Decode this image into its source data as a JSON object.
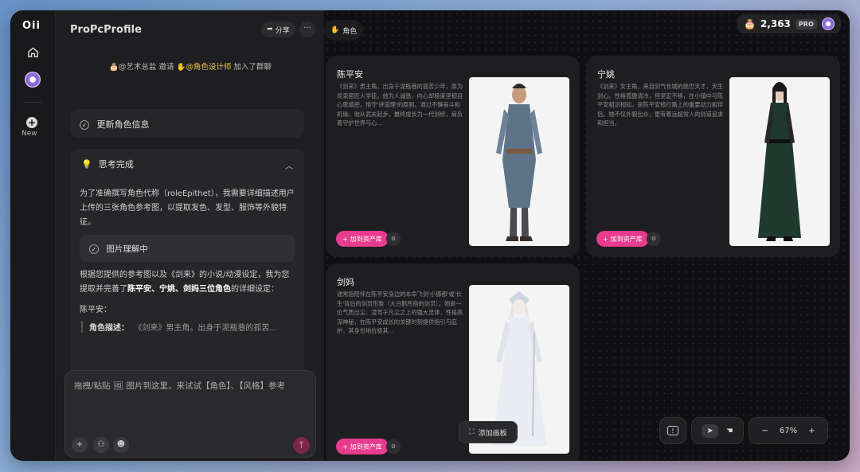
{
  "app": {
    "logo": "Oii",
    "new_label": "New"
  },
  "chat": {
    "title": "ProPcProfile",
    "share_label": "分享",
    "more_label": "···",
    "join_actor": "@艺术总监",
    "join_verb": "邀请",
    "join_target": "@角色设计师",
    "join_suffix": "加入了群聊",
    "update_card": "更新角色信息",
    "think_title": "思考完成",
    "think_para1": "为了准确撰写角色代称（roleEpithet），我需要详细描述用户上传的三张角色参考图，以提取发色、发型、服饰等外貌特征。",
    "sub_card": "图片理解中",
    "think_para2_a": "根据您提供的参考图以及《剑来》的小说/动漫设定，我为您提取并完善了",
    "think_para2_b": "陈平安、宁姚、剑妈三位角色",
    "think_para2_c": "的详细设定：",
    "char_label": "陈平安：",
    "quote_key": "角色描述：",
    "quote_val": "《剑来》男主角。出身于泥瓶巷的孤苦...",
    "input_placeholder": "拖拽/粘贴 🖼 图片到这里，来试试【角色】、【风格】参考"
  },
  "canvas": {
    "tag": "角色",
    "credits": "2,363",
    "plan": "PRO",
    "add_board": "添加画板",
    "zoom": "67%",
    "characters": [
      {
        "name": "陈平安",
        "desc": "《剑来》男主角。出身于泥瓶巷的孤苦少年，原为龙泉窑匠人学徒。他为人诚恳，内心却极度坚韧且心思缜密，恪守'讲道理'的原则。通过不懈奋斗和机缘，他从武夫起步，最终成长为一代剑修，肩负着守护世界与心...",
        "action": "加到资产库"
      },
      {
        "name": "宁姚",
        "desc": "《剑来》女主角。来自剑气长城的绝世天才，天生剑心。性格孤傲清冷，但坚定不移，在小镇中与陈平安相识相知，是陈平安修行路上的重要动力和伴侣。她不仅外貌出众，更有着远超常人的剑道追求和担当。",
        "action": "加到资产库"
      },
      {
        "name": "剑妈",
        "desc": "通常指陪伴在陈平安身边的本命飞剑'小挪都'或'长生'背后的剑灵形象（大白鹅所指的剑灵）。她是一位气质出尘、凌驾于凡尘之上的强大灵体，性格高深神秘，在陈平安成长的关键时刻提供指引与庇护，其身份地位极其...",
        "action": "加到资产库"
      }
    ]
  }
}
